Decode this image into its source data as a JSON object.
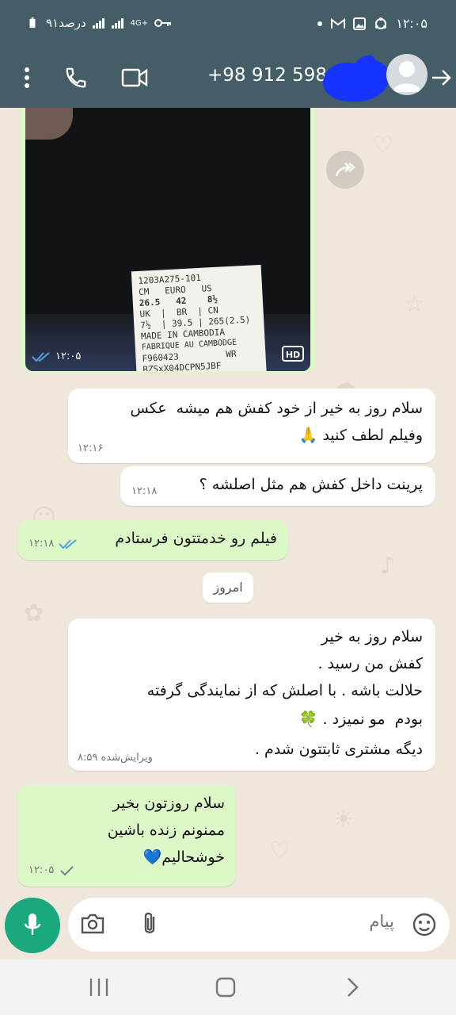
{
  "status_bar": {
    "time": "۱۲:۰۵",
    "battery": "۹۱درصد",
    "network": "4G+"
  },
  "header": {
    "contact": "+98 912 598"
  },
  "label_text": {
    "lines": [
      "1203A275-101",
      "CM   EURO   US",
      "26.5   42    8½",
      "UK  |  BR  | CN",
      "7½  | 39.5 | 265(2.5)",
      "MADE IN CAMBODIA",
      "FABRIQUE AU CAMBODGE",
      "F960423         WR",
      "BZSxX04DCPN5JBF"
    ]
  },
  "messages": [
    {
      "id": "m0",
      "time": "۱۲:۰۵",
      "hd": "HD"
    },
    {
      "id": "m1",
      "lines": [
        "سلام روز به خیر از خود کفش هم میشه  عکس",
        "وفیلم لطف کنید 🙏"
      ],
      "time": "۱۲:۱۶"
    },
    {
      "id": "m2",
      "lines": [
        "پرینت داخل کفش هم مثل اصلشه ؟"
      ],
      "time": "۱۲:۱۸"
    },
    {
      "id": "m3",
      "lines": [
        "فیلم رو خدمتتون فرستادم"
      ],
      "time": "۱۲:۱۸"
    },
    {
      "id": "m4",
      "lines": [
        "سلام روز به خیر",
        "کفش من رسید .",
        "حلالت باشه . با اصلش که از نمایندگی گرفته",
        "بودم  مو نمیزد . 🍀",
        "دیگه مشتری ثابتتون شدم ."
      ],
      "time": "ویرایش‌شده ۸:۵۹"
    },
    {
      "id": "m5",
      "lines": [
        "سلام روزتون بخیر",
        "ممنونم زنده باشین",
        "خوشحالیم💙"
      ],
      "time": "۱۲:۰۵"
    }
  ],
  "date_chip": "امروز",
  "input": {
    "placeholder": "پیام"
  },
  "colors": {
    "header": "#445d66",
    "incoming_bubble": "#ffffff",
    "outgoing_bubble": "#dcf8c6",
    "mic_button": "#1aa97f",
    "read_ticks": "#4fa3e0"
  }
}
